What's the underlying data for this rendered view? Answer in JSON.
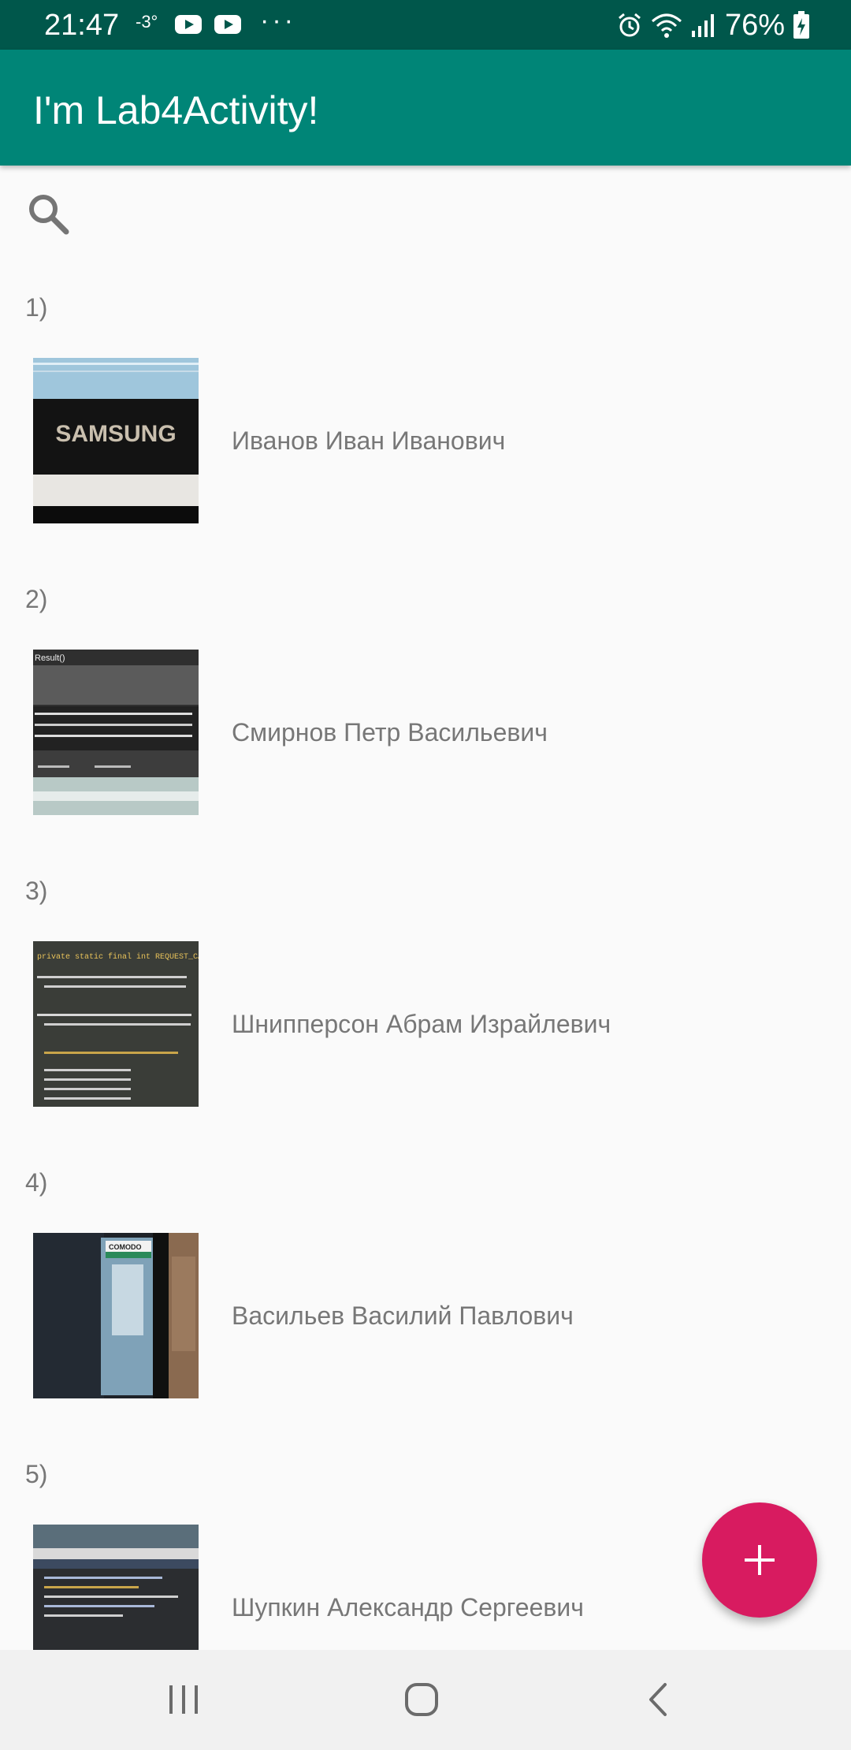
{
  "status_bar": {
    "time": "21:47",
    "temperature": "-3°",
    "overflow": "···",
    "battery": "76%"
  },
  "app_bar": {
    "title": "I'm Lab4Activity!"
  },
  "search": {
    "icon": "search-icon"
  },
  "students": [
    {
      "number": "1)",
      "name": "Иванов Иван Иванович",
      "thumb_caption": "SAMSUNG"
    },
    {
      "number": "2)",
      "name": "Смирнов Петр Васильевич",
      "thumb_caption": "Result()"
    },
    {
      "number": "3)",
      "name": "Шнипперсон Абрам Израйлевич",
      "thumb_caption": "private static final int REQUEST_CAMERA"
    },
    {
      "number": "4)",
      "name": "Васильев Василий Павлович",
      "thumb_caption": "COMODO"
    },
    {
      "number": "5)",
      "name": "Шупкин Александр Сергеевич",
      "thumb_caption": ""
    }
  ],
  "fab": {
    "icon": "plus-icon"
  },
  "nav_bar": {
    "recents": "recents-icon",
    "home": "home-icon",
    "back": "back-icon"
  },
  "colors": {
    "status_bar": "#00574b",
    "app_bar": "#008577",
    "accent": "#d81b60",
    "background": "#fafafa",
    "text_secondary": "#777777"
  }
}
